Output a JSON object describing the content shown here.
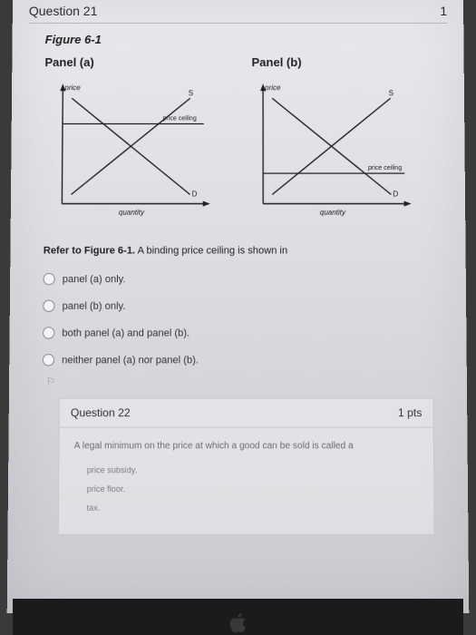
{
  "top": {
    "question_label": "Question 21",
    "page_num": "1"
  },
  "figure": {
    "title": "Figure 6-1",
    "panel_a_label": "Panel (a)",
    "panel_b_label": "Panel (b)"
  },
  "chart_data": [
    {
      "type": "line",
      "title": "Panel (a)",
      "xlabel": "quantity",
      "ylabel": "price",
      "series": [
        {
          "name": "S",
          "values": "upward-sloping"
        },
        {
          "name": "D",
          "values": "downward-sloping"
        },
        {
          "name": "price ceiling",
          "values": "horizontal-above-equilibrium"
        }
      ]
    },
    {
      "type": "line",
      "title": "Panel (b)",
      "xlabel": "quantity",
      "ylabel": "price",
      "series": [
        {
          "name": "S",
          "values": "upward-sloping"
        },
        {
          "name": "D",
          "values": "downward-sloping"
        },
        {
          "name": "price ceiling",
          "values": "horizontal-below-equilibrium"
        }
      ]
    }
  ],
  "panel_a": {
    "y_axis": "price",
    "x_axis": "quantity",
    "s_label": "S",
    "d_label": "D",
    "ceiling_label": "price ceiling"
  },
  "panel_b": {
    "y_axis": "price",
    "x_axis": "quantity",
    "s_label": "S",
    "d_label": "D",
    "ceiling_label": "price ceiling"
  },
  "refer_text_prefix": "Refer to Figure 6-1.",
  "refer_text_rest": " A binding price ceiling is shown in",
  "options": {
    "a": "panel (a) only.",
    "b": "panel (b) only.",
    "c": "both panel (a) and panel (b).",
    "d": "neither panel (a) nor panel (b)."
  },
  "q22": {
    "flag": "⚐",
    "title": "Question 22",
    "pts": "1 pts",
    "prompt": "A legal minimum on the price at which a good can be sold is called a",
    "opts": {
      "a": "price subsidy.",
      "b": "price floor.",
      "c": "tax."
    }
  }
}
